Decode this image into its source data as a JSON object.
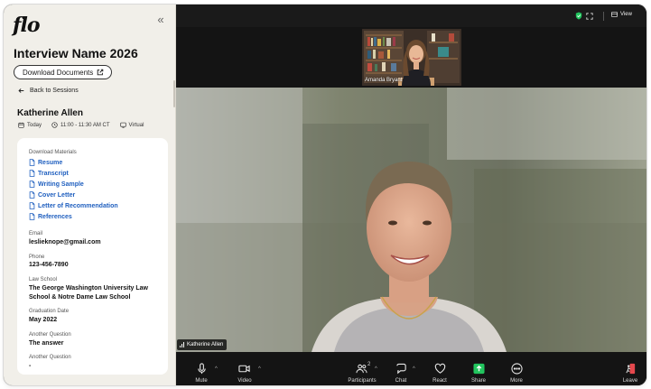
{
  "sidebar": {
    "logo": "flo",
    "collapse_icon": "«",
    "title": "Interview Name 2026",
    "download_button": "Download Documents",
    "back_link": "Back to Sessions",
    "candidate_name": "Katherine Allen",
    "meta": {
      "date": "Today",
      "time": "11:00 - 11:30 AM CT",
      "location": "Virtual"
    },
    "card": {
      "materials_label": "Download Materials",
      "documents": [
        "Resume",
        "Transcript",
        "Writing Sample",
        "Cover Letter",
        "Letter of Recommendation",
        "References"
      ],
      "fields": [
        {
          "label": "Email",
          "value": "leslieknope@gmail.com"
        },
        {
          "label": "Phone",
          "value": "123-456-7890"
        },
        {
          "label": "Law School",
          "value_line1": "The George Washington University Law",
          "value_line2": "School & Notre Dame Law School"
        },
        {
          "label": "Graduation Date",
          "value": "May 2022"
        },
        {
          "label": "Another Question",
          "value": "The answer"
        },
        {
          "label": "Another Question",
          "value": "-"
        }
      ]
    }
  },
  "video": {
    "view_label": "View",
    "thumbnail_name": "Amanda Bryant",
    "main_name": "Katherine Allen",
    "accent_green": "#22c55e",
    "share_green": "#22c55e",
    "leave_red": "#e5484d",
    "controls": {
      "mute": "Mute",
      "video": "Video",
      "participants": "Participants",
      "participants_count": "2",
      "chat": "Chat",
      "react": "React",
      "share": "Share",
      "more": "More",
      "leave": "Leave"
    }
  }
}
